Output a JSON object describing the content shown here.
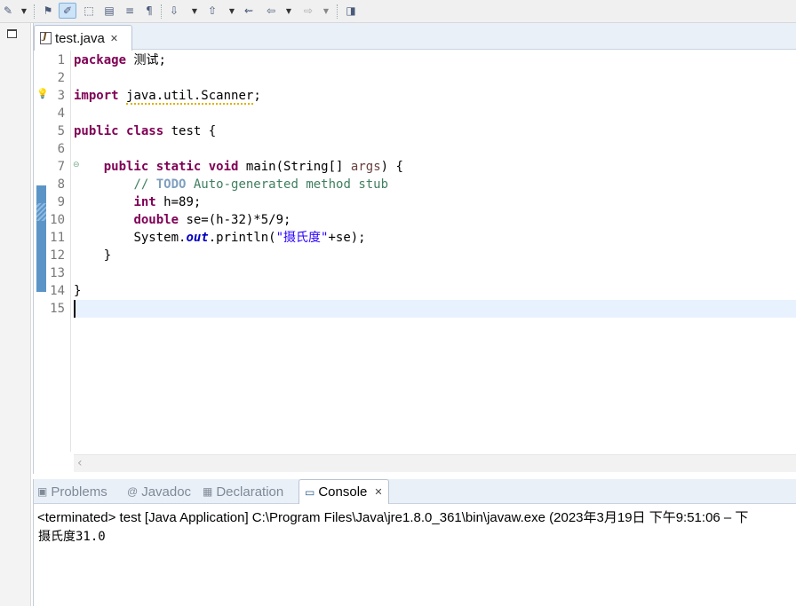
{
  "editor": {
    "tab_label": "test.java",
    "current_line": 15,
    "line_numbers": [
      "1",
      "2",
      "3",
      "4",
      "5",
      "6",
      "7",
      "8",
      "9",
      "10",
      "11",
      "12",
      "13",
      "14",
      "15"
    ],
    "code": {
      "l1_kw": "package",
      "l1_rest": " 测试;",
      "l3_kw": "import",
      "l3_sp": " ",
      "l3_import": "java.util.Scanner",
      "l3_end": ";",
      "l5_kw1": "public",
      "l5_kw2": "class",
      "l5_rest": " test {",
      "l7_kw1": "public",
      "l7_kw2": "static",
      "l7_kw3": "void",
      "l7_a": " main(String[] ",
      "l7_var": "args",
      "l7_b": ") {",
      "l8_a": "// ",
      "l8_todo": "TODO",
      "l8_b": " Auto-generated method stub",
      "l9_kw": "int",
      "l9_rest": " h=89;",
      "l10_kw": "double",
      "l10_rest": " se=(h-32)*5/9;",
      "l11_a": "System.",
      "l11_field": "out",
      "l11_b": ".println(",
      "l11_str": "\"摄氏度\"",
      "l11_c": "+se);",
      "l12": "}",
      "l14": "}"
    }
  },
  "console": {
    "tabs": [
      {
        "label": "Problems",
        "active": false
      },
      {
        "label": "Javadoc",
        "active": false
      },
      {
        "label": "Declaration",
        "active": false
      },
      {
        "label": "Console",
        "active": true
      }
    ],
    "status": "<terminated> test [Java Application] C:\\Program Files\\Java\\jre1.8.0_361\\bin\\javaw.exe  (2023年3月19日 下午9:51:06 – 下",
    "output": "摄氏度31.0"
  },
  "colors": {
    "keyword": "#7f0055",
    "comment": "#3f7f5f",
    "string": "#2a00ff",
    "current_line": "#e8f2fe",
    "change_marker": "#5b95c8"
  }
}
